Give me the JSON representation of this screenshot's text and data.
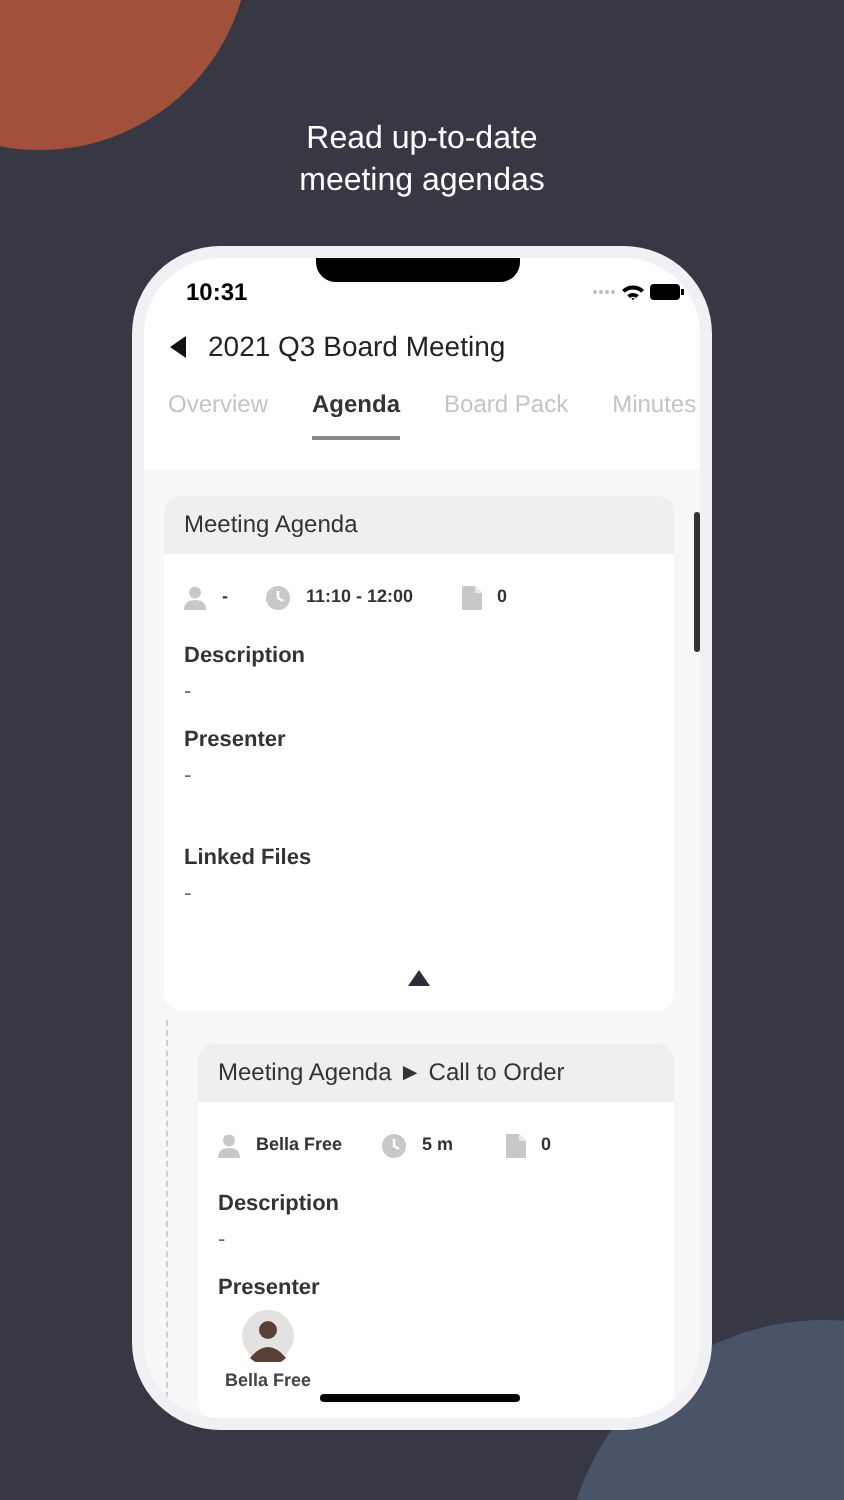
{
  "headline": [
    "Read up-to-date",
    "meeting agendas"
  ],
  "status_bar": {
    "time": "10:31"
  },
  "header": {
    "title": "2021 Q3 Board Meeting"
  },
  "tabs": [
    {
      "label": "Overview",
      "selected": false
    },
    {
      "label": "Agenda",
      "selected": true
    },
    {
      "label": "Board Pack",
      "selected": false
    },
    {
      "label": "Minutes",
      "selected": false
    }
  ],
  "cards": [
    {
      "title": "Meeting Agenda",
      "nested": false,
      "expanded": true,
      "meta": {
        "presenter": "-",
        "time": "11:10 - 12:00",
        "files": "0"
      },
      "fields": [
        {
          "kind": "text",
          "label": "Description",
          "value": "-"
        },
        {
          "kind": "text",
          "label": "Presenter",
          "value": "-"
        },
        {
          "kind": "files",
          "label": "Linked Files",
          "value": "-"
        }
      ]
    },
    {
      "title": "Meeting Agenda ► Call to Order",
      "nested": true,
      "meta": {
        "presenter": "Bella Free",
        "time": "5 m",
        "files": "0"
      },
      "fields": [
        {
          "kind": "text",
          "label": "Description",
          "value": "-"
        },
        {
          "kind": "person",
          "label": "Presenter",
          "value": "Bella Free"
        }
      ]
    }
  ]
}
